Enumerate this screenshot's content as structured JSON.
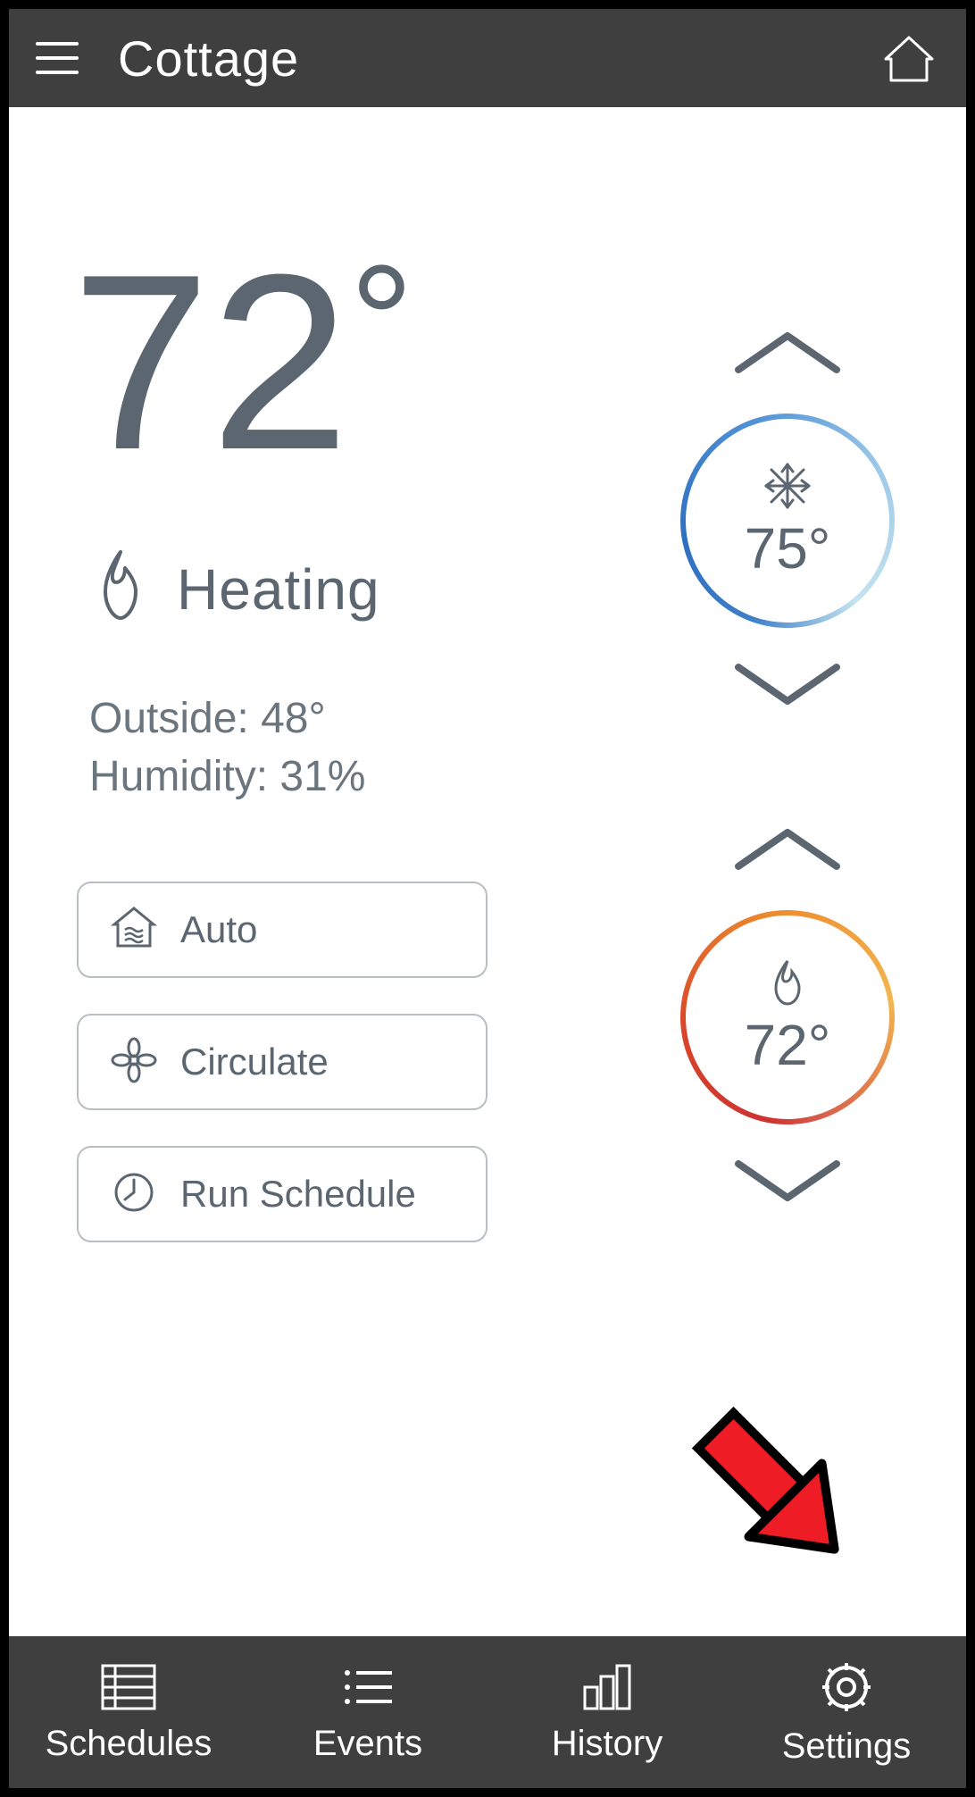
{
  "header": {
    "title": "Cottage"
  },
  "main": {
    "current_temp": "72",
    "degree": "°",
    "status": "Heating",
    "outside_label": "Outside:",
    "outside_value": "48°",
    "humidity_label": "Humidity:",
    "humidity_value": "31%"
  },
  "setpoints": {
    "cool": "75°",
    "heat": "72°"
  },
  "mode_buttons": {
    "auto": "Auto",
    "circulate": "Circulate",
    "run_schedule": "Run Schedule"
  },
  "tabs": {
    "schedules": "Schedules",
    "events": "Events",
    "history": "History",
    "settings": "Settings"
  },
  "annotation": {
    "target": "settings-tab"
  }
}
